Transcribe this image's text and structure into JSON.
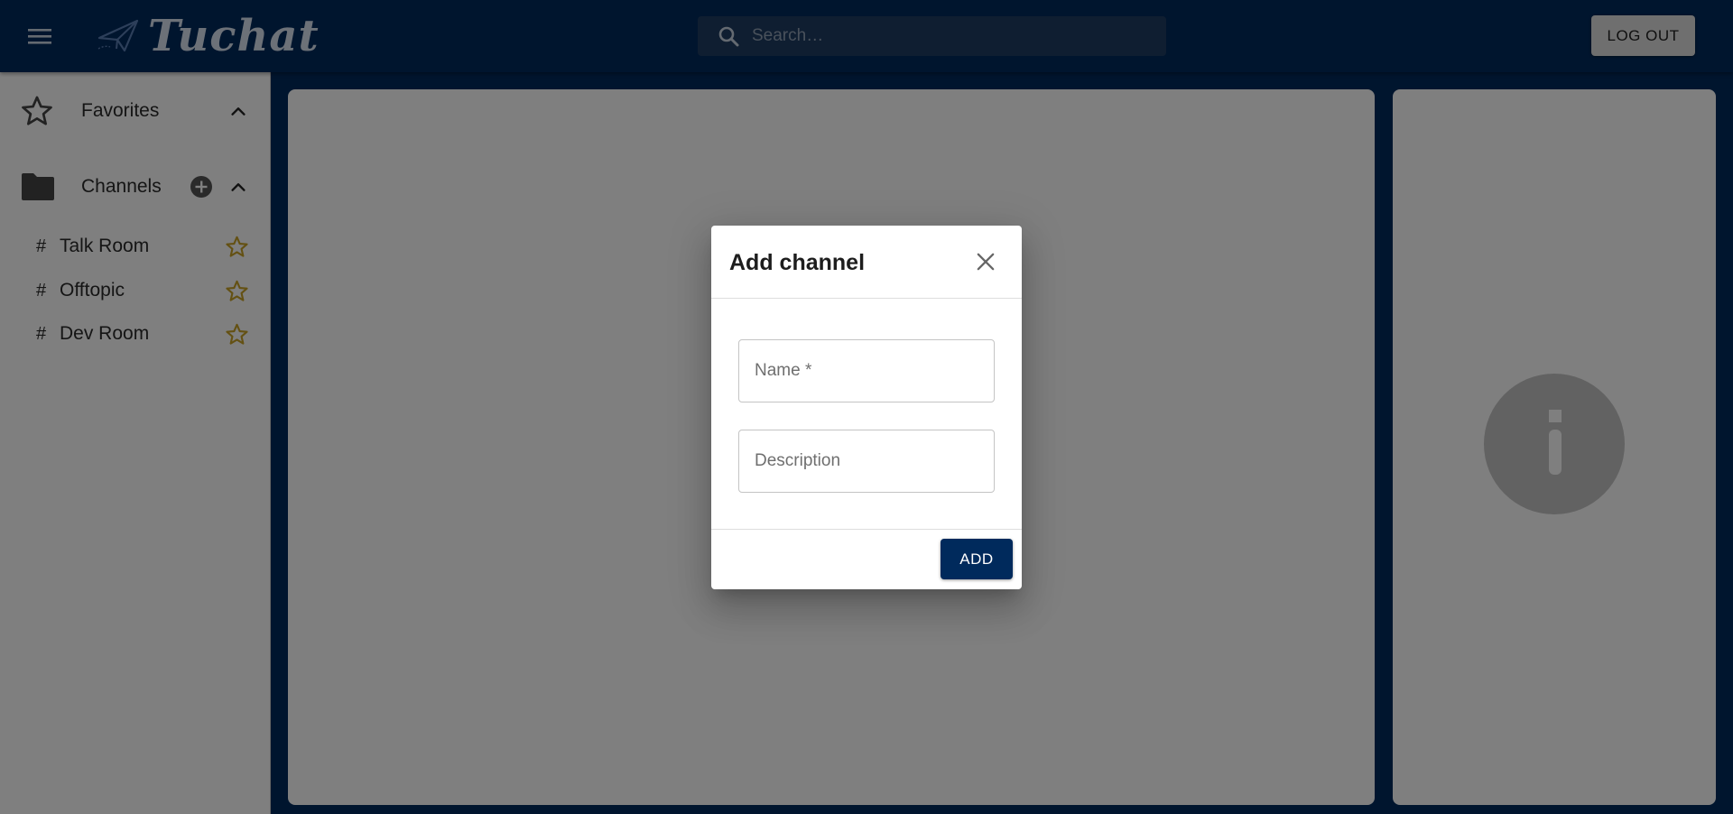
{
  "app": {
    "name": "Tuchat",
    "brand_color": "#002a5c"
  },
  "header": {
    "menu_icon": "hamburger-menu-icon",
    "logo_icon": "paper-plane-icon",
    "search": {
      "placeholder": "Search…",
      "value": ""
    },
    "logout_label": "LOG OUT"
  },
  "sidebar": {
    "favorites": {
      "label": "Favorites",
      "icon": "star-outline-icon",
      "expanded": true
    },
    "channels": {
      "label": "Channels",
      "icon": "folder-icon",
      "expanded": true,
      "items": [
        {
          "hash": "#",
          "name": "Talk Room",
          "favorite_icon": "star-outline-icon"
        },
        {
          "hash": "#",
          "name": "Offtopic",
          "favorite_icon": "star-outline-icon"
        },
        {
          "hash": "#",
          "name": "Dev Room",
          "favorite_icon": "star-outline-icon"
        }
      ]
    },
    "star_color": "#c9a227"
  },
  "info_panel": {
    "icon": "info-icon"
  },
  "dialog": {
    "title": "Add channel",
    "fields": {
      "name": {
        "placeholder": "Name *",
        "value": ""
      },
      "description": {
        "placeholder": "Description",
        "value": ""
      }
    },
    "add_label": "ADD"
  }
}
